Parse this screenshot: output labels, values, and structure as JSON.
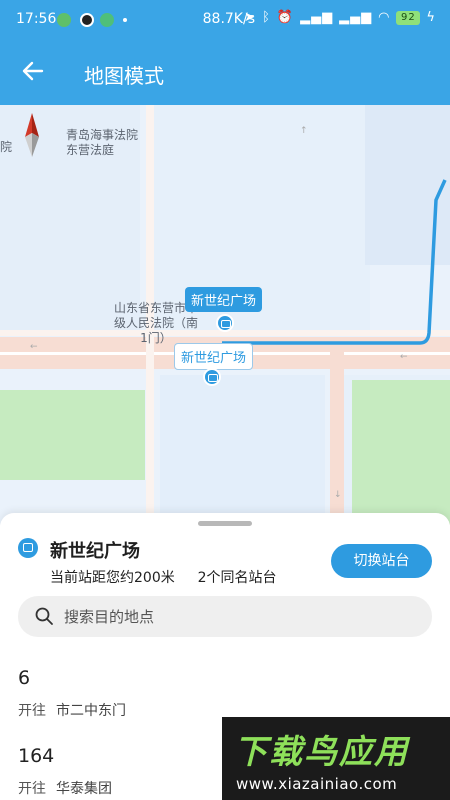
{
  "status_bar": {
    "time": "17:56",
    "network_speed": "88.7K/s",
    "battery": "92",
    "icons": [
      "location-icon",
      "bluetooth-icon",
      "alarm-icon",
      "signal-icon",
      "signal-icon",
      "wifi-icon",
      "battery-icon",
      "charging-icon"
    ]
  },
  "header": {
    "title": "地图模式"
  },
  "map": {
    "labels": {
      "court_name": "青岛海事法院东营法庭",
      "court_edge": "院",
      "court2": "山东省东营市中级人民法院（南1门）"
    },
    "stops": [
      {
        "name": "新世纪广场",
        "active": true
      },
      {
        "name": "新世纪广场",
        "active": false
      }
    ]
  },
  "sheet": {
    "station_name": "新世纪广场",
    "distance_text": "当前站距您约200米",
    "same_name_text": "2个同名站台",
    "switch_button": "切换站台",
    "search_placeholder": "搜索目的地点",
    "routes": [
      {
        "number": "6",
        "dir_label": "开往",
        "destination": "市二中东门"
      },
      {
        "number": "164",
        "dir_label": "开往",
        "destination": "华泰集团"
      }
    ]
  },
  "watermark": {
    "brand": "下载鸟应用",
    "url": "www.xiazainiao.com"
  },
  "colors": {
    "primary": "#3aa5e6",
    "accent": "#2e9be0"
  }
}
